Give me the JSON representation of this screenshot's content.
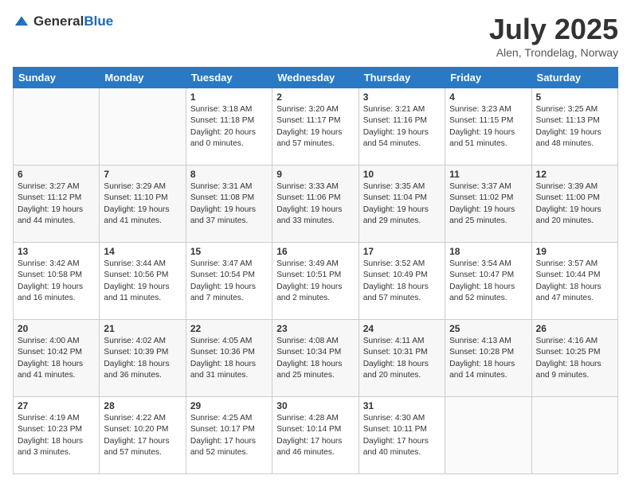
{
  "logo": {
    "general": "General",
    "blue": "Blue"
  },
  "header": {
    "title": "July 2025",
    "subtitle": "Alen, Trondelag, Norway"
  },
  "columns": [
    "Sunday",
    "Monday",
    "Tuesday",
    "Wednesday",
    "Thursday",
    "Friday",
    "Saturday"
  ],
  "weeks": [
    [
      {
        "day": "",
        "info": ""
      },
      {
        "day": "",
        "info": ""
      },
      {
        "day": "1",
        "info": "Sunrise: 3:18 AM\nSunset: 11:18 PM\nDaylight: 20 hours and 0 minutes."
      },
      {
        "day": "2",
        "info": "Sunrise: 3:20 AM\nSunset: 11:17 PM\nDaylight: 19 hours and 57 minutes."
      },
      {
        "day": "3",
        "info": "Sunrise: 3:21 AM\nSunset: 11:16 PM\nDaylight: 19 hours and 54 minutes."
      },
      {
        "day": "4",
        "info": "Sunrise: 3:23 AM\nSunset: 11:15 PM\nDaylight: 19 hours and 51 minutes."
      },
      {
        "day": "5",
        "info": "Sunrise: 3:25 AM\nSunset: 11:13 PM\nDaylight: 19 hours and 48 minutes."
      }
    ],
    [
      {
        "day": "6",
        "info": "Sunrise: 3:27 AM\nSunset: 11:12 PM\nDaylight: 19 hours and 44 minutes."
      },
      {
        "day": "7",
        "info": "Sunrise: 3:29 AM\nSunset: 11:10 PM\nDaylight: 19 hours and 41 minutes."
      },
      {
        "day": "8",
        "info": "Sunrise: 3:31 AM\nSunset: 11:08 PM\nDaylight: 19 hours and 37 minutes."
      },
      {
        "day": "9",
        "info": "Sunrise: 3:33 AM\nSunset: 11:06 PM\nDaylight: 19 hours and 33 minutes."
      },
      {
        "day": "10",
        "info": "Sunrise: 3:35 AM\nSunset: 11:04 PM\nDaylight: 19 hours and 29 minutes."
      },
      {
        "day": "11",
        "info": "Sunrise: 3:37 AM\nSunset: 11:02 PM\nDaylight: 19 hours and 25 minutes."
      },
      {
        "day": "12",
        "info": "Sunrise: 3:39 AM\nSunset: 11:00 PM\nDaylight: 19 hours and 20 minutes."
      }
    ],
    [
      {
        "day": "13",
        "info": "Sunrise: 3:42 AM\nSunset: 10:58 PM\nDaylight: 19 hours and 16 minutes."
      },
      {
        "day": "14",
        "info": "Sunrise: 3:44 AM\nSunset: 10:56 PM\nDaylight: 19 hours and 11 minutes."
      },
      {
        "day": "15",
        "info": "Sunrise: 3:47 AM\nSunset: 10:54 PM\nDaylight: 19 hours and 7 minutes."
      },
      {
        "day": "16",
        "info": "Sunrise: 3:49 AM\nSunset: 10:51 PM\nDaylight: 19 hours and 2 minutes."
      },
      {
        "day": "17",
        "info": "Sunrise: 3:52 AM\nSunset: 10:49 PM\nDaylight: 18 hours and 57 minutes."
      },
      {
        "day": "18",
        "info": "Sunrise: 3:54 AM\nSunset: 10:47 PM\nDaylight: 18 hours and 52 minutes."
      },
      {
        "day": "19",
        "info": "Sunrise: 3:57 AM\nSunset: 10:44 PM\nDaylight: 18 hours and 47 minutes."
      }
    ],
    [
      {
        "day": "20",
        "info": "Sunrise: 4:00 AM\nSunset: 10:42 PM\nDaylight: 18 hours and 41 minutes."
      },
      {
        "day": "21",
        "info": "Sunrise: 4:02 AM\nSunset: 10:39 PM\nDaylight: 18 hours and 36 minutes."
      },
      {
        "day": "22",
        "info": "Sunrise: 4:05 AM\nSunset: 10:36 PM\nDaylight: 18 hours and 31 minutes."
      },
      {
        "day": "23",
        "info": "Sunrise: 4:08 AM\nSunset: 10:34 PM\nDaylight: 18 hours and 25 minutes."
      },
      {
        "day": "24",
        "info": "Sunrise: 4:11 AM\nSunset: 10:31 PM\nDaylight: 18 hours and 20 minutes."
      },
      {
        "day": "25",
        "info": "Sunrise: 4:13 AM\nSunset: 10:28 PM\nDaylight: 18 hours and 14 minutes."
      },
      {
        "day": "26",
        "info": "Sunrise: 4:16 AM\nSunset: 10:25 PM\nDaylight: 18 hours and 9 minutes."
      }
    ],
    [
      {
        "day": "27",
        "info": "Sunrise: 4:19 AM\nSunset: 10:23 PM\nDaylight: 18 hours and 3 minutes."
      },
      {
        "day": "28",
        "info": "Sunrise: 4:22 AM\nSunset: 10:20 PM\nDaylight: 17 hours and 57 minutes."
      },
      {
        "day": "29",
        "info": "Sunrise: 4:25 AM\nSunset: 10:17 PM\nDaylight: 17 hours and 52 minutes."
      },
      {
        "day": "30",
        "info": "Sunrise: 4:28 AM\nSunset: 10:14 PM\nDaylight: 17 hours and 46 minutes."
      },
      {
        "day": "31",
        "info": "Sunrise: 4:30 AM\nSunset: 10:11 PM\nDaylight: 17 hours and 40 minutes."
      },
      {
        "day": "",
        "info": ""
      },
      {
        "day": "",
        "info": ""
      }
    ]
  ]
}
